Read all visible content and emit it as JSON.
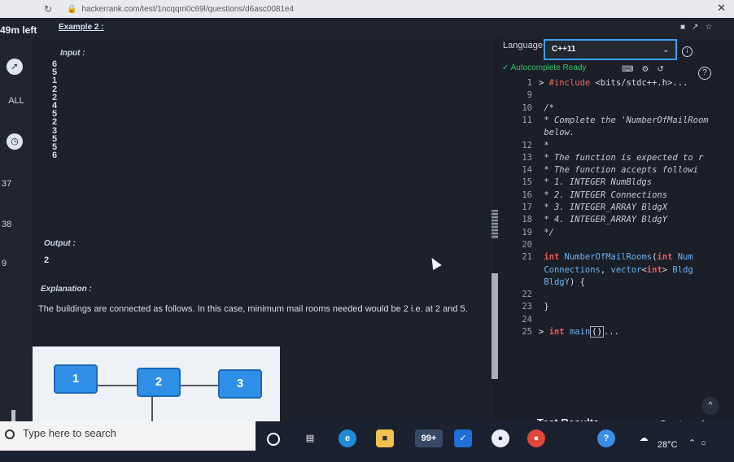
{
  "browser": {
    "url": "hackerrank.com/test/1ncqqm0c69l/questions/d6asc0081e4"
  },
  "header": {
    "time_left": "49m left",
    "example_title": "Example 2 :"
  },
  "left_rail": {
    "all_label": "ALL",
    "numbers": [
      "37",
      "38",
      "9"
    ]
  },
  "problem": {
    "input_label": "Input :",
    "input_values": [
      "6",
      "5",
      "1",
      "2",
      "2",
      "4",
      "5",
      "2",
      "3",
      "5",
      "5",
      "6"
    ],
    "output_label": "Output :",
    "output_value": "2",
    "explanation_label": "Explanation :",
    "explanation_text": "The buildings are connected as follows. In this case, minimum mail rooms needed would be 2 i.e. at 2 and 5.",
    "graph_nodes": [
      "1",
      "2",
      "3"
    ]
  },
  "editor": {
    "language_label": "Language",
    "language_value": "C++11",
    "autocomplete_status": "Autocomplete Ready",
    "code_lines": [
      {
        "n": "1",
        "fold": ">",
        "parts": [
          {
            "c": "tok-pre",
            "t": "#include "
          },
          {
            "c": "tok-str",
            "t": "<bits/stdc++.h>"
          },
          {
            "c": "tok-plain",
            "t": "..."
          }
        ]
      },
      {
        "n": "9",
        "fold": "",
        "parts": []
      },
      {
        "n": "10",
        "fold": "",
        "parts": [
          {
            "c": "tok-com",
            "t": "/*"
          }
        ]
      },
      {
        "n": "11",
        "fold": "",
        "parts": [
          {
            "c": "tok-com",
            "t": " * Complete the 'NumberOfMailRoom"
          }
        ]
      },
      {
        "n": "",
        "fold": "",
        "parts": [
          {
            "c": "tok-com",
            "t": "below."
          }
        ]
      },
      {
        "n": "12",
        "fold": "",
        "parts": [
          {
            "c": "tok-com",
            "t": " *"
          }
        ]
      },
      {
        "n": "13",
        "fold": "",
        "parts": [
          {
            "c": "tok-com",
            "t": " * The function is expected to r"
          }
        ]
      },
      {
        "n": "14",
        "fold": "",
        "parts": [
          {
            "c": "tok-com",
            "t": " * The function accepts followi"
          }
        ]
      },
      {
        "n": "15",
        "fold": "",
        "parts": [
          {
            "c": "tok-com",
            "t": " *  1. INTEGER NumBldgs"
          }
        ]
      },
      {
        "n": "16",
        "fold": "",
        "parts": [
          {
            "c": "tok-com",
            "t": " *  2. INTEGER Connections"
          }
        ]
      },
      {
        "n": "17",
        "fold": "",
        "parts": [
          {
            "c": "tok-com",
            "t": " *  3. INTEGER_ARRAY BldgX"
          }
        ]
      },
      {
        "n": "18",
        "fold": "",
        "parts": [
          {
            "c": "tok-com",
            "t": " *  4. INTEGER_ARRAY BldgY"
          }
        ]
      },
      {
        "n": "19",
        "fold": "",
        "parts": [
          {
            "c": "tok-com",
            "t": " */"
          }
        ]
      },
      {
        "n": "20",
        "fold": "",
        "parts": []
      },
      {
        "n": "21",
        "fold": "",
        "parts": [
          {
            "c": "tok-kw",
            "t": "int "
          },
          {
            "c": "tok-fn",
            "t": "NumberOfMailRooms"
          },
          {
            "c": "tok-plain",
            "t": "("
          },
          {
            "c": "tok-kw",
            "t": "int "
          },
          {
            "c": "tok-fn",
            "t": "Num"
          }
        ]
      },
      {
        "n": "",
        "fold": "",
        "parts": [
          {
            "c": "tok-fn",
            "t": "Connections"
          },
          {
            "c": "tok-plain",
            "t": ", "
          },
          {
            "c": "tok-fn",
            "t": "vector"
          },
          {
            "c": "tok-plain",
            "t": "<"
          },
          {
            "c": "tok-kw",
            "t": "int"
          },
          {
            "c": "tok-plain",
            "t": "> "
          },
          {
            "c": "tok-fn",
            "t": "Bldg"
          }
        ]
      },
      {
        "n": "",
        "fold": "",
        "parts": [
          {
            "c": "tok-fn",
            "t": "BldgY"
          },
          {
            "c": "tok-plain",
            "t": ") {"
          }
        ]
      },
      {
        "n": "22",
        "fold": "",
        "parts": []
      },
      {
        "n": "23",
        "fold": "",
        "parts": [
          {
            "c": "tok-plain",
            "t": "}"
          }
        ]
      },
      {
        "n": "24",
        "fold": "",
        "parts": []
      },
      {
        "n": "25",
        "fold": ">",
        "parts": [
          {
            "c": "tok-kw",
            "t": "int "
          },
          {
            "c": "tok-fn",
            "t": "main"
          },
          {
            "c": "bracket-box",
            "t": "()"
          },
          {
            "c": "tok-plain",
            "t": "..."
          }
        ]
      }
    ],
    "test_results_tab": "Test Results",
    "custom_input_tab": "Custom Inp"
  },
  "taskbar": {
    "search_placeholder": "Type here to search",
    "badge_count": "99+",
    "temperature": "28°C"
  }
}
